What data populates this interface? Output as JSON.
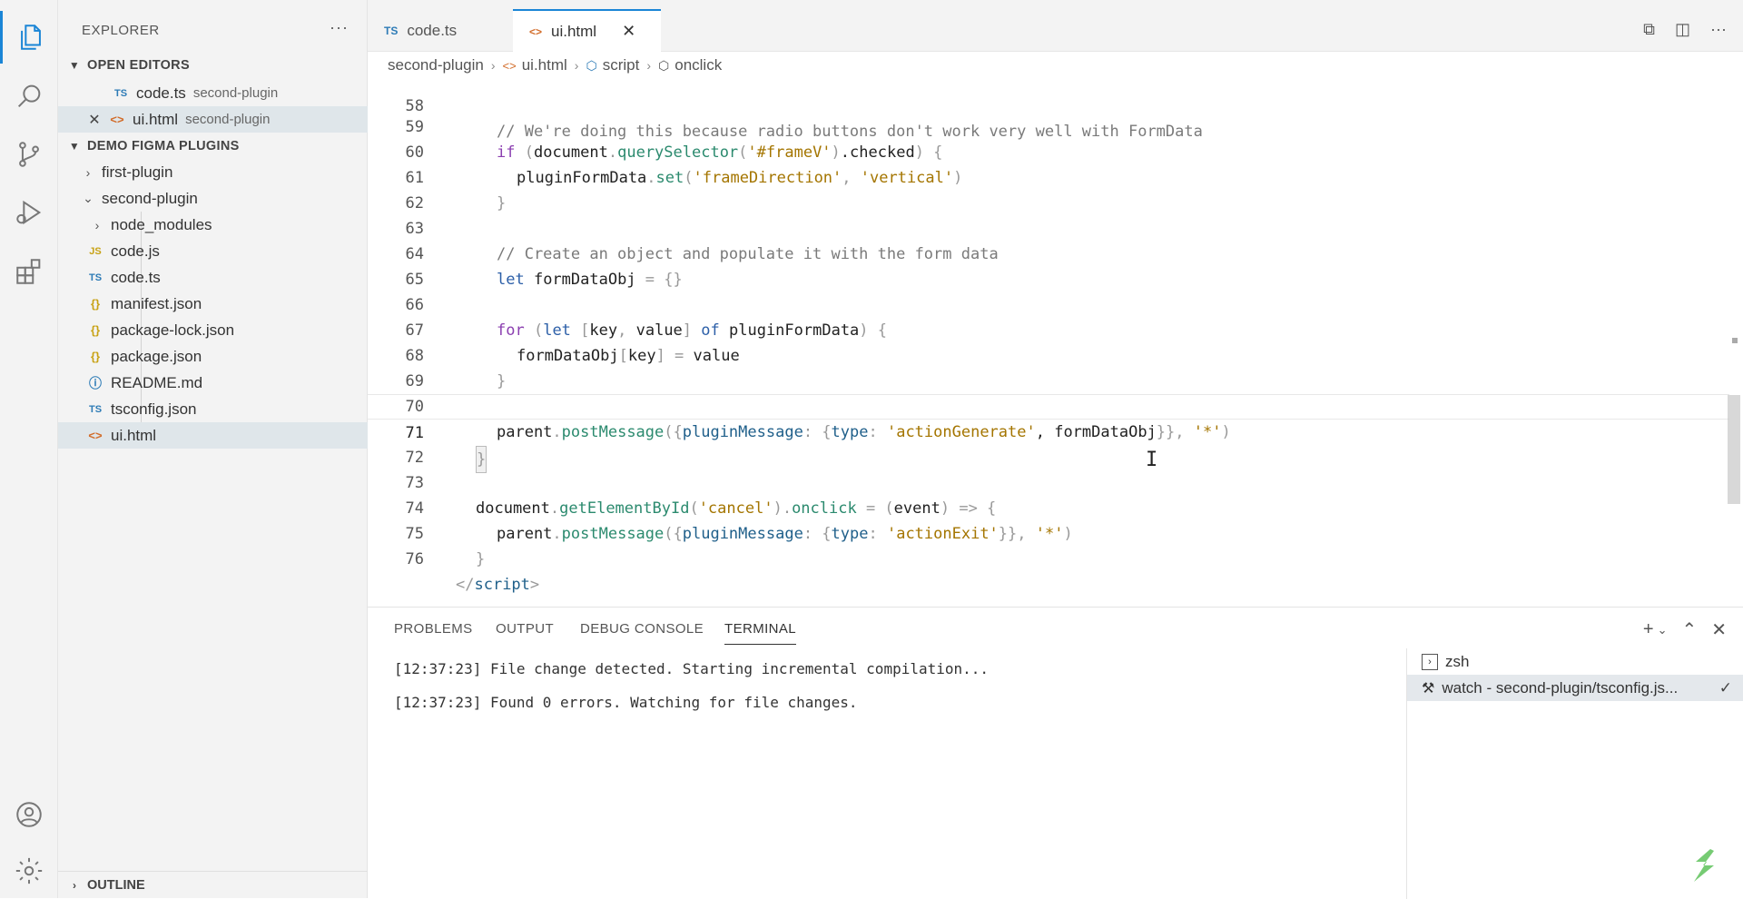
{
  "sidebar": {
    "title": "EXPLORER",
    "open_editors_label": "OPEN EDITORS",
    "open_editors": [
      {
        "icon": "TS",
        "name": "code.ts",
        "desc": "second-plugin"
      },
      {
        "icon": "<>",
        "name": "ui.html",
        "desc": "second-plugin"
      }
    ],
    "project_label": "DEMO FIGMA PLUGINS",
    "tree": [
      {
        "name": "first-plugin"
      },
      {
        "name": "second-plugin"
      },
      {
        "name": "node_modules"
      },
      {
        "icon": "JS",
        "name": "code.js"
      },
      {
        "icon": "TS",
        "name": "code.ts"
      },
      {
        "icon": "{}",
        "name": "manifest.json"
      },
      {
        "icon": "{}",
        "name": "package-lock.json"
      },
      {
        "icon": "{}",
        "name": "package.json"
      },
      {
        "icon": "ⓘ",
        "name": "README.md"
      },
      {
        "icon": "TS",
        "name": "tsconfig.json"
      },
      {
        "icon": "<>",
        "name": "ui.html"
      }
    ],
    "outline_label": "OUTLINE"
  },
  "tabs": [
    {
      "icon": "TS",
      "label": "code.ts"
    },
    {
      "icon": "<>",
      "label": "ui.html"
    }
  ],
  "breadcrumb": [
    "second-plugin",
    "ui.html",
    "script",
    "onclick"
  ],
  "editor": {
    "line_numbers": [
      "58",
      "59",
      "60",
      "61",
      "62",
      "63",
      "64",
      "65",
      "66",
      "67",
      "68",
      "69",
      "70",
      "71",
      "72",
      "73",
      "74",
      "75",
      "76"
    ],
    "lines": [
      [
        "// We're doing this because radio buttons don't work very well with FormData"
      ],
      [
        "if",
        " (",
        "document",
        ".",
        "querySelector",
        "(",
        "'#frameV'",
        ")",
        ".checked",
        ") {"
      ],
      [
        "pluginFormData",
        ".",
        "set",
        "(",
        "'frameDirection'",
        ", ",
        "'vertical'",
        ")"
      ],
      [
        "}"
      ],
      [],
      [
        "// Create an object and populate it with the form data"
      ],
      [
        "let",
        " formDataObj ",
        "=",
        " {}"
      ],
      [],
      [
        "for",
        " (",
        "let",
        " [",
        "key",
        ", ",
        "value",
        "] ",
        "of",
        " pluginFormData",
        ") {"
      ],
      [
        "formDataObj",
        "[",
        "key",
        "] ",
        "=",
        " value"
      ],
      [
        "}"
      ],
      [],
      [
        "parent",
        ".",
        "postMessage",
        "({",
        "pluginMessage",
        ": {",
        "type",
        ": ",
        "'actionGenerate'",
        ", formDataObj",
        "}}, ",
        "'*'",
        ")"
      ],
      [
        "}"
      ],
      [],
      [
        "document",
        ".",
        "getElementById",
        "(",
        "'cancel'",
        ").",
        "onclick",
        " = (",
        "event",
        ") => {"
      ],
      [
        "parent",
        ".",
        "postMessage",
        "({",
        "pluginMessage",
        ": {",
        "type",
        ": ",
        "'actionExit'",
        "}}, ",
        "'*'",
        ")"
      ],
      [
        "}"
      ],
      [
        "</",
        "script",
        ">"
      ]
    ]
  },
  "panel": {
    "tabs": [
      "PROBLEMS",
      "OUTPUT",
      "DEBUG CONSOLE",
      "TERMINAL"
    ],
    "terminal_lines": [
      "[12:37:23] File change detected. Starting incremental compilation...",
      "[12:37:23] Found 0 errors. Watching for file changes."
    ],
    "terminals": [
      {
        "name": "zsh"
      },
      {
        "name": "watch - second-plugin/tsconfig.js..."
      }
    ]
  }
}
